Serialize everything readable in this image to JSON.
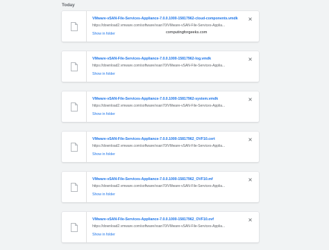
{
  "section": {
    "title": "Today"
  },
  "watermark": "computingforgeeks.com",
  "downloads": [
    {
      "filename": "VMware-vSAN-File-Services-Appliance-7.0.0.1000-15817962-cloud-components.vmdk",
      "url": "https://download2.vmware.com/software/vsan70/VMware-vSAN-File-Services-Applia...",
      "action": "Show in folder"
    },
    {
      "filename": "VMware-vSAN-File-Services-Appliance-7.0.0.1000-15817962-log.vmdk",
      "url": "https://download2.vmware.com/software/vsan70/VMware-vSAN-File-Services-Applia...",
      "action": "Show in folder"
    },
    {
      "filename": "VMware-vSAN-File-Services-Appliance-7.0.0.1000-15817962-system.vmdk",
      "url": "https://download2.vmware.com/software/vsan70/VMware-vSAN-File-Services-Applia...",
      "action": "Show in folder"
    },
    {
      "filename": "VMware-vSAN-File-Services-Appliance-7.0.0.1000-15817962_OVF10.cert",
      "url": "https://download2.vmware.com/software/vsan70/VMware-vSAN-File-Services-Applia...",
      "action": "Show in folder"
    },
    {
      "filename": "VMware-vSAN-File-Services-Appliance-7.0.0.1000-15817962_OVF10.mf",
      "url": "https://download2.vmware.com/software/vsan70/VMware-vSAN-File-Services-Applia...",
      "action": "Show in folder"
    },
    {
      "filename": "VMware-vSAN-File-Services-Appliance-7.0.0.1000-15817962_OVF10.ovf",
      "url": "https://download2.vmware.com/software/vsan70/VMware-vSAN-File-Services-Applia...",
      "action": "Show in folder"
    }
  ]
}
